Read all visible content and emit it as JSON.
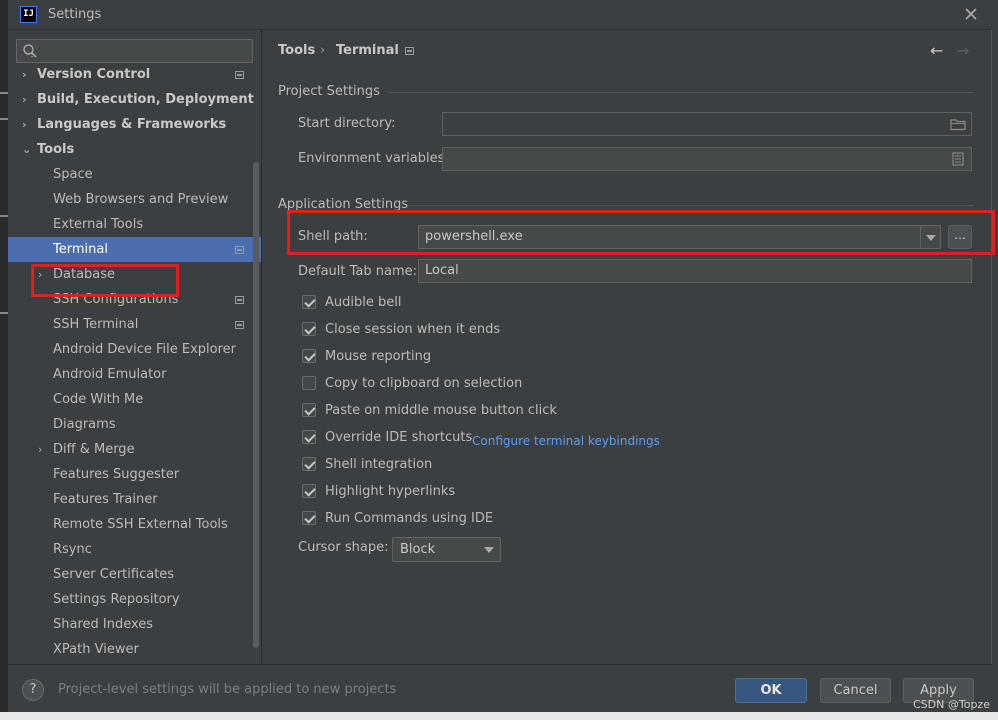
{
  "window": {
    "title": "Settings",
    "app_icon": "IJ"
  },
  "search": {
    "placeholder": ""
  },
  "tree": {
    "items": [
      {
        "label": "Version Control",
        "level": 0,
        "arrow": "›",
        "bold": true,
        "project": true
      },
      {
        "label": "Build, Execution, Deployment",
        "level": 0,
        "arrow": "›",
        "bold": true
      },
      {
        "label": "Languages & Frameworks",
        "level": 0,
        "arrow": "›",
        "bold": true
      },
      {
        "label": "Tools",
        "level": 0,
        "arrow": "⌄",
        "bold": true
      },
      {
        "label": "Space",
        "level": 1
      },
      {
        "label": "Web Browsers and Preview",
        "level": 1
      },
      {
        "label": "External Tools",
        "level": 1
      },
      {
        "label": "Terminal",
        "level": 1,
        "selected": true,
        "project": true
      },
      {
        "label": "Database",
        "level": 1,
        "arrow": "›"
      },
      {
        "label": "SSH Configurations",
        "level": 1,
        "project": true
      },
      {
        "label": "SSH Terminal",
        "level": 1,
        "project": true
      },
      {
        "label": "Android Device File Explorer",
        "level": 1
      },
      {
        "label": "Android Emulator",
        "level": 1
      },
      {
        "label": "Code With Me",
        "level": 1
      },
      {
        "label": "Diagrams",
        "level": 1
      },
      {
        "label": "Diff & Merge",
        "level": 1,
        "arrow": "›"
      },
      {
        "label": "Features Suggester",
        "level": 1
      },
      {
        "label": "Features Trainer",
        "level": 1
      },
      {
        "label": "Remote SSH External Tools",
        "level": 1
      },
      {
        "label": "Rsync",
        "level": 1
      },
      {
        "label": "Server Certificates",
        "level": 1
      },
      {
        "label": "Settings Repository",
        "level": 1
      },
      {
        "label": "Shared Indexes",
        "level": 1
      },
      {
        "label": "XPath Viewer",
        "level": 1
      }
    ]
  },
  "breadcrumb": {
    "parent": "Tools",
    "separator": "›",
    "current": "Terminal"
  },
  "nav": {
    "back": "←",
    "forward": "→"
  },
  "project_settings": {
    "title": "Project Settings",
    "start_directory_label": "Start directory:",
    "start_directory_value": "",
    "env_vars_label": "Environment variables:",
    "env_vars_value": ""
  },
  "app_settings": {
    "title": "Application Settings",
    "shell_path_label": "Shell path:",
    "shell_path_value": "powershell.exe",
    "browse_label": "...",
    "default_tab_label": "Default Tab name:",
    "default_tab_value": "Local",
    "checkboxes": [
      {
        "label": "Audible bell",
        "checked": true
      },
      {
        "label": "Close session when it ends",
        "checked": true
      },
      {
        "label": "Mouse reporting",
        "checked": true
      },
      {
        "label": "Copy to clipboard on selection",
        "checked": false
      },
      {
        "label": "Paste on middle mouse button click",
        "checked": true
      },
      {
        "label": "Override IDE shortcuts",
        "checked": true
      },
      {
        "label": "Shell integration",
        "checked": true
      },
      {
        "label": "Highlight hyperlinks",
        "checked": true
      },
      {
        "label": "Run Commands using IDE",
        "checked": true
      }
    ],
    "keybindings_link": "Configure terminal keybindings",
    "cursor_shape_label": "Cursor shape:",
    "cursor_shape_value": "Block"
  },
  "footer": {
    "help": "?",
    "note": "Project-level settings will be applied to new projects",
    "ok": "OK",
    "cancel": "Cancel",
    "apply": "Apply",
    "watermark": "CSDN @Topze"
  },
  "colors": {
    "accent": "#4b6eaf",
    "highlight": "#e0201d",
    "link": "#589df6",
    "ok_button": "#365880"
  }
}
